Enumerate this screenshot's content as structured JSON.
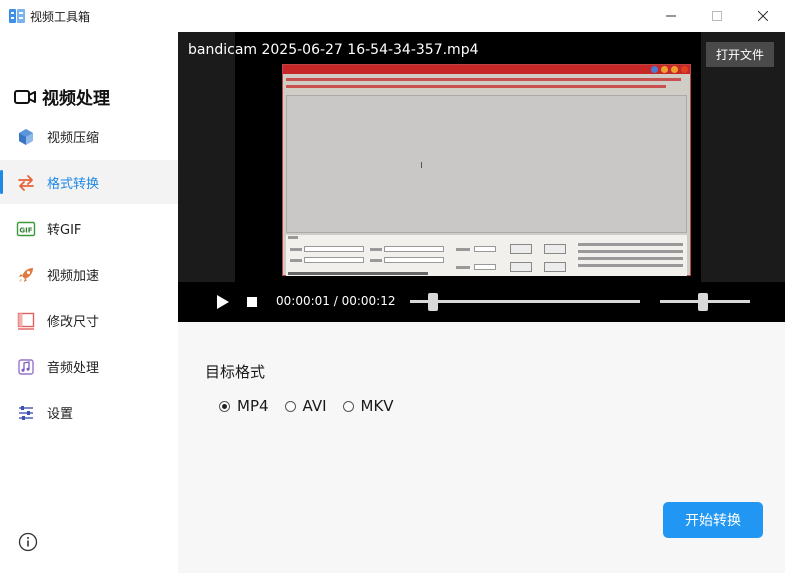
{
  "window": {
    "title": "视频工具箱"
  },
  "sidebar": {
    "header": "视频处理",
    "items": [
      {
        "label": "视频压缩",
        "icon": "cube-icon"
      },
      {
        "label": "格式转换",
        "icon": "swap-arrows-icon",
        "active": true
      },
      {
        "label": "转GIF",
        "icon": "gif-icon"
      },
      {
        "label": "视频加速",
        "icon": "rocket-icon"
      },
      {
        "label": "修改尺寸",
        "icon": "resize-icon"
      },
      {
        "label": "音频处理",
        "icon": "music-note-icon"
      },
      {
        "label": "设置",
        "icon": "settings-sliders-icon"
      }
    ]
  },
  "player": {
    "file_name": "bandicam 2025-06-27 16-54-34-357.mp4",
    "open_file_label": "打开文件",
    "time_display": "00:00:01 / 00:00:12",
    "progress_fraction": 0.08,
    "volume_fraction": 0.48
  },
  "format": {
    "title": "目标格式",
    "options": [
      "MP4",
      "AVI",
      "MKV"
    ],
    "selected": "MP4",
    "start_label": "开始转换"
  },
  "colors": {
    "accent": "#2196f3",
    "sidebar_active_text": "#1e88e5",
    "player_bg": "#000000",
    "panel_bg": "#f7f7f7"
  }
}
